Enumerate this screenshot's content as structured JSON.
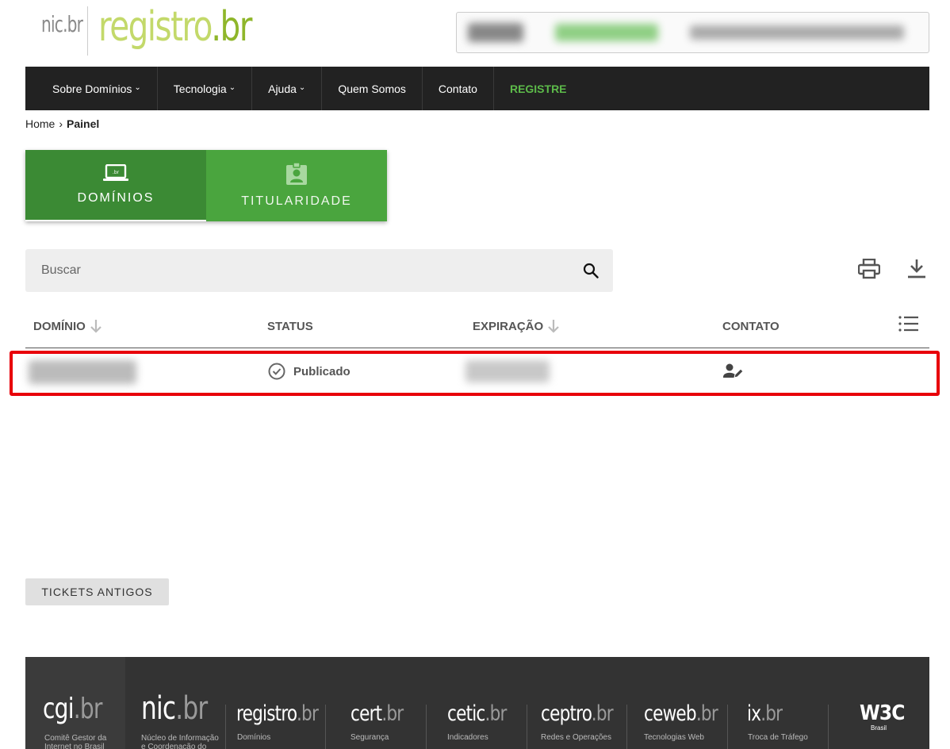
{
  "header": {
    "logo_nic": "nic",
    "logo_nic_dot": ".br",
    "logo_registro": "registro",
    "logo_registro_dot": ".br"
  },
  "nav": {
    "items": [
      {
        "label": "Sobre Domínios",
        "dropdown": true
      },
      {
        "label": "Tecnologia",
        "dropdown": true
      },
      {
        "label": "Ajuda",
        "dropdown": true
      },
      {
        "label": "Quem Somos",
        "dropdown": false
      },
      {
        "label": "Contato",
        "dropdown": false
      },
      {
        "label": "REGISTRE",
        "dropdown": false
      }
    ],
    "chevron": "⌄"
  },
  "breadcrumb": {
    "home": "Home",
    "separator": "›",
    "current": "Painel"
  },
  "tabs": {
    "domains": "DOMÍNIOS",
    "ownership": "TITULARIDADE"
  },
  "search": {
    "placeholder": "Buscar"
  },
  "table": {
    "columns": {
      "domain": "DOMÍNIO",
      "status": "STATUS",
      "expiration": "EXPIRAÇÃO",
      "contact": "CONTATO"
    },
    "rows": [
      {
        "status": "Publicado"
      }
    ]
  },
  "tickets": {
    "label": "TICKETS ANTIGOS"
  },
  "footer": {
    "cgi": {
      "a": "cgi",
      "b": ".br",
      "sub1": "Comitê Gestor da",
      "sub2": "Internet no Brasil"
    },
    "nic": {
      "a": "nic",
      "b": ".br",
      "sub1": "Núcleo de Informação",
      "sub2": "e Coordenação do"
    },
    "registro": {
      "a": "registro",
      "b": ".br",
      "sub": "Domínios"
    },
    "cert": {
      "a": "cert",
      "b": ".br",
      "sub": "Segurança"
    },
    "cetic": {
      "a": "cetic",
      "b": ".br",
      "sub": "Indicadores"
    },
    "ceptro": {
      "a": "ceptro",
      "b": ".br",
      "sub": "Redes e Operações"
    },
    "ceweb": {
      "a": "ceweb",
      "b": ".br",
      "sub": "Tecnologias Web"
    },
    "ix": {
      "a": "ix",
      "b": ".br",
      "sub": "Troca de Tráfego"
    },
    "w3c": {
      "a": "W3C",
      "sub": "Brasil"
    }
  },
  "colors": {
    "nav_bg": "#222222",
    "accent_green": "#5dbb4a",
    "tab_active": "#3b8a34",
    "tab_inactive": "#4aa53e",
    "highlight_red": "#e8000a",
    "footer_bg": "#333333"
  }
}
